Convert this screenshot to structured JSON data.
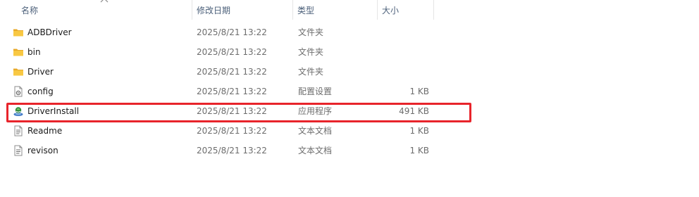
{
  "columns": {
    "name": "名称",
    "date": "修改日期",
    "type": "类型",
    "size": "大小"
  },
  "files": [
    {
      "name": "ADBDriver",
      "date": "2025/8/21 13:22",
      "type": "文件夹",
      "size": "",
      "icon": "folder-icon"
    },
    {
      "name": "bin",
      "date": "2025/8/21 13:22",
      "type": "文件夹",
      "size": "",
      "icon": "folder-icon"
    },
    {
      "name": "Driver",
      "date": "2025/8/21 13:22",
      "type": "文件夹",
      "size": "",
      "icon": "folder-icon"
    },
    {
      "name": "config",
      "date": "2025/8/21 13:22",
      "type": "配置设置",
      "size": "1 KB",
      "icon": "config-file-icon"
    },
    {
      "name": "DriverInstall",
      "date": "2025/8/21 13:22",
      "type": "应用程序",
      "size": "491 KB",
      "icon": "installer-app-icon"
    },
    {
      "name": "Readme",
      "date": "2025/8/21 13:22",
      "type": "文本文档",
      "size": "1 KB",
      "icon": "text-file-icon"
    },
    {
      "name": "revison",
      "date": "2025/8/21 13:22",
      "type": "文本文档",
      "size": "1 KB",
      "icon": "text-file-icon"
    }
  ],
  "highlighted_file": "DriverInstall",
  "colors": {
    "highlight_border": "#e8242b",
    "folder": "#f8c843",
    "header_text": "#4c607a"
  }
}
